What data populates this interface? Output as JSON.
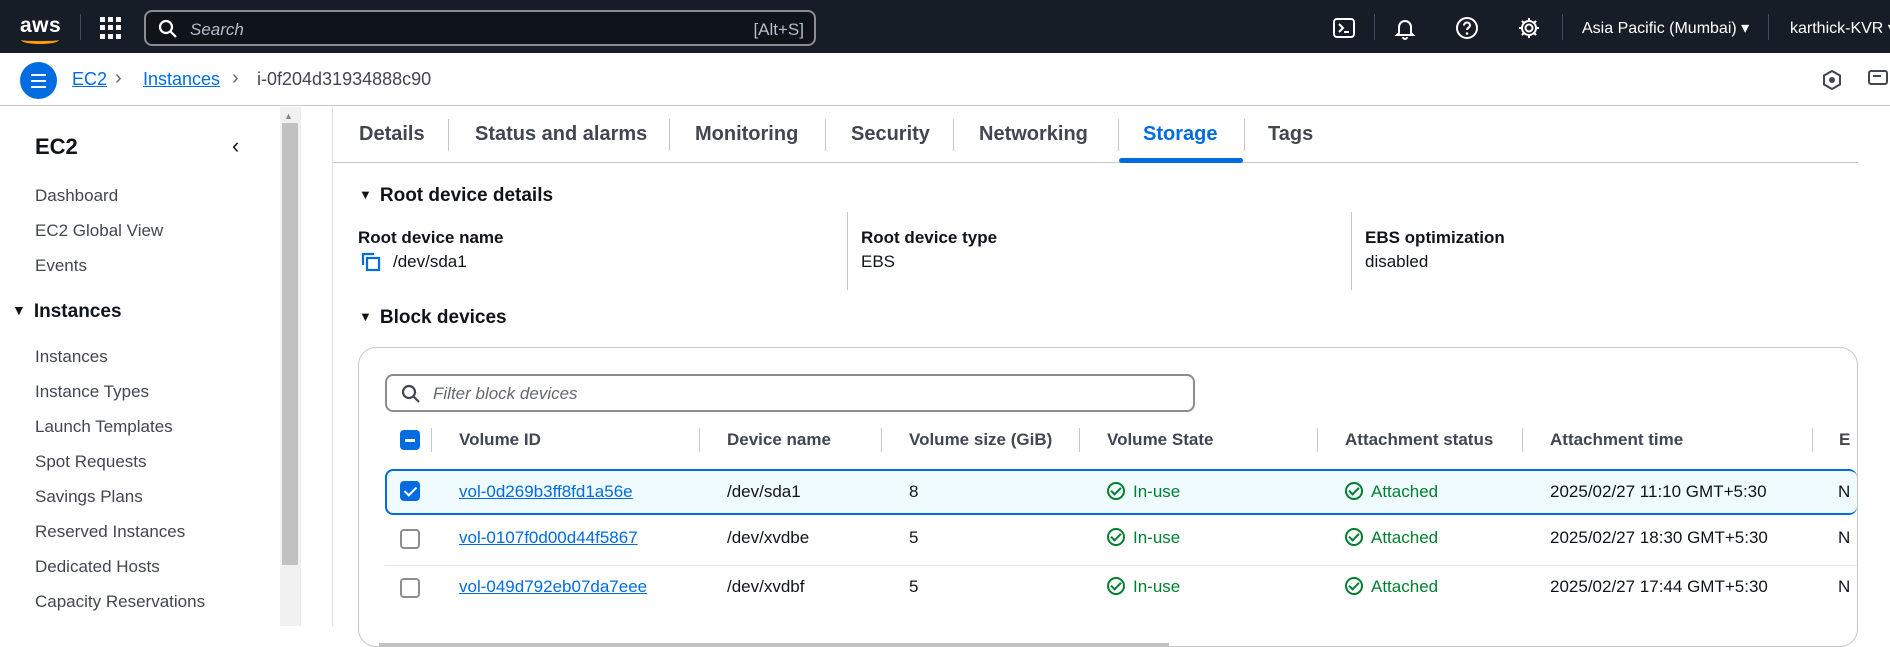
{
  "topnav": {
    "logo": "aws",
    "search_placeholder": "Search",
    "search_shortcut": "[Alt+S]",
    "region": "Asia Pacific (Mumbai) ▾",
    "user": "karthick-KVR ▾",
    "icons": [
      "cloudshell-icon",
      "bell-icon",
      "help-icon",
      "gear-icon"
    ]
  },
  "breadcrumb": {
    "items": [
      "EC2",
      "Instances",
      "i-0f204d31934888c90"
    ],
    "separator": "›"
  },
  "sidebar": {
    "title": "EC2",
    "collapse": "‹",
    "top_items": [
      "Dashboard",
      "EC2 Global View",
      "Events"
    ],
    "section": {
      "label": "Instances",
      "toggle": "▼",
      "items": [
        "Instances",
        "Instance Types",
        "Launch Templates",
        "Spot Requests",
        "Savings Plans",
        "Reserved Instances",
        "Dedicated Hosts",
        "Capacity Reservations"
      ]
    }
  },
  "tabs": {
    "items": [
      "Details",
      "Status and alarms",
      "Monitoring",
      "Security",
      "Networking",
      "Storage",
      "Tags"
    ],
    "active": "Storage"
  },
  "root_device": {
    "header": "Root device details",
    "toggle": "▼",
    "name_label": "Root device name",
    "name_value": "/dev/sda1",
    "type_label": "Root device type",
    "type_value": "EBS",
    "ebs_label": "EBS optimization",
    "ebs_value": "disabled"
  },
  "block_devices": {
    "header": "Block devices",
    "toggle": "▼",
    "filter_placeholder": "Filter block devices",
    "columns": [
      "Volume ID",
      "Device name",
      "Volume size (GiB)",
      "Volume State",
      "Attachment status",
      "Attachment time",
      "E"
    ],
    "rows": [
      {
        "volume_id": "vol-0d269b3ff8fd1a56e",
        "device": "/dev/sda1",
        "size": "8",
        "state": "In-use",
        "attach_status": "Attached",
        "attach_time": "2025/02/27 11:10 GMT+5:30",
        "trunc": "N",
        "selected": true
      },
      {
        "volume_id": "vol-0107f0d00d44f5867",
        "device": "/dev/xvdbe",
        "size": "5",
        "state": "In-use",
        "attach_status": "Attached",
        "attach_time": "2025/02/27 18:30 GMT+5:30",
        "trunc": "N",
        "selected": false
      },
      {
        "volume_id": "vol-049d792eb07da7eee",
        "device": "/dev/xvdbf",
        "size": "5",
        "state": "In-use",
        "attach_status": "Attached",
        "attach_time": "2025/02/27 17:44 GMT+5:30",
        "trunc": "N",
        "selected": false
      }
    ]
  },
  "colors": {
    "nav_bg": "#161d26",
    "accent": "#006ce0",
    "success": "#00802f",
    "aws_orange": "#ff9900"
  }
}
